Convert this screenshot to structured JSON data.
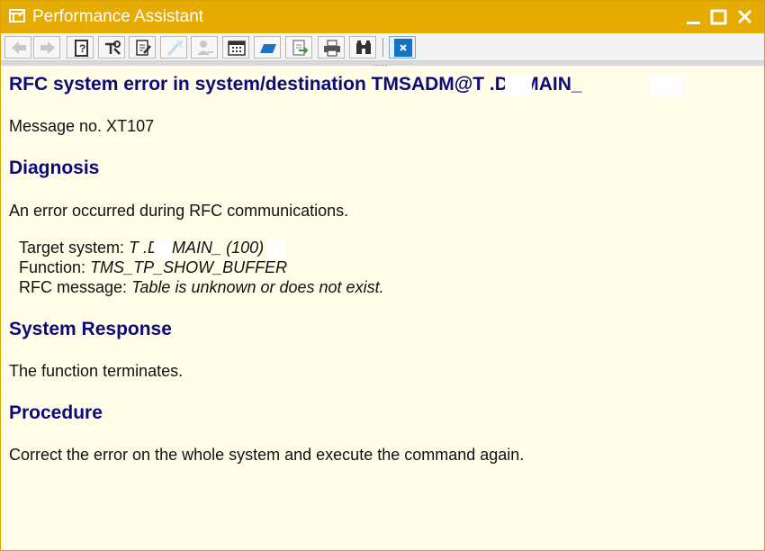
{
  "window": {
    "title": "Performance Assistant"
  },
  "toolbar": {
    "buttons": [
      "back-icon",
      "forward-icon",
      "help-book-icon",
      "tools-icon",
      "edit-doc-icon",
      "wand-icon",
      "user-key-icon",
      "calendar-icon",
      "flag-icon",
      "export-icon",
      "print-icon",
      "binoculars-icon",
      "close-small-icon"
    ]
  },
  "message": {
    "title": "RFC system error in system/destination TMSADM@T  .DOMAIN_",
    "number": "Message no. XT107"
  },
  "diagnosis": {
    "heading": "Diagnosis",
    "text": "An error occurred during RFC communications.",
    "target_label": "Target system:",
    "target_value": "T  .DOMAIN_  (100)",
    "function_label": "Function:",
    "function_value": "TMS_TP_SHOW_BUFFER",
    "rfc_label": "RFC message:",
    "rfc_value": "Table is unknown or does not exist."
  },
  "response": {
    "heading": "System Response",
    "text": "The function terminates."
  },
  "procedure": {
    "heading": "Procedure",
    "text": "Correct the error on the whole system and execute the command again."
  }
}
